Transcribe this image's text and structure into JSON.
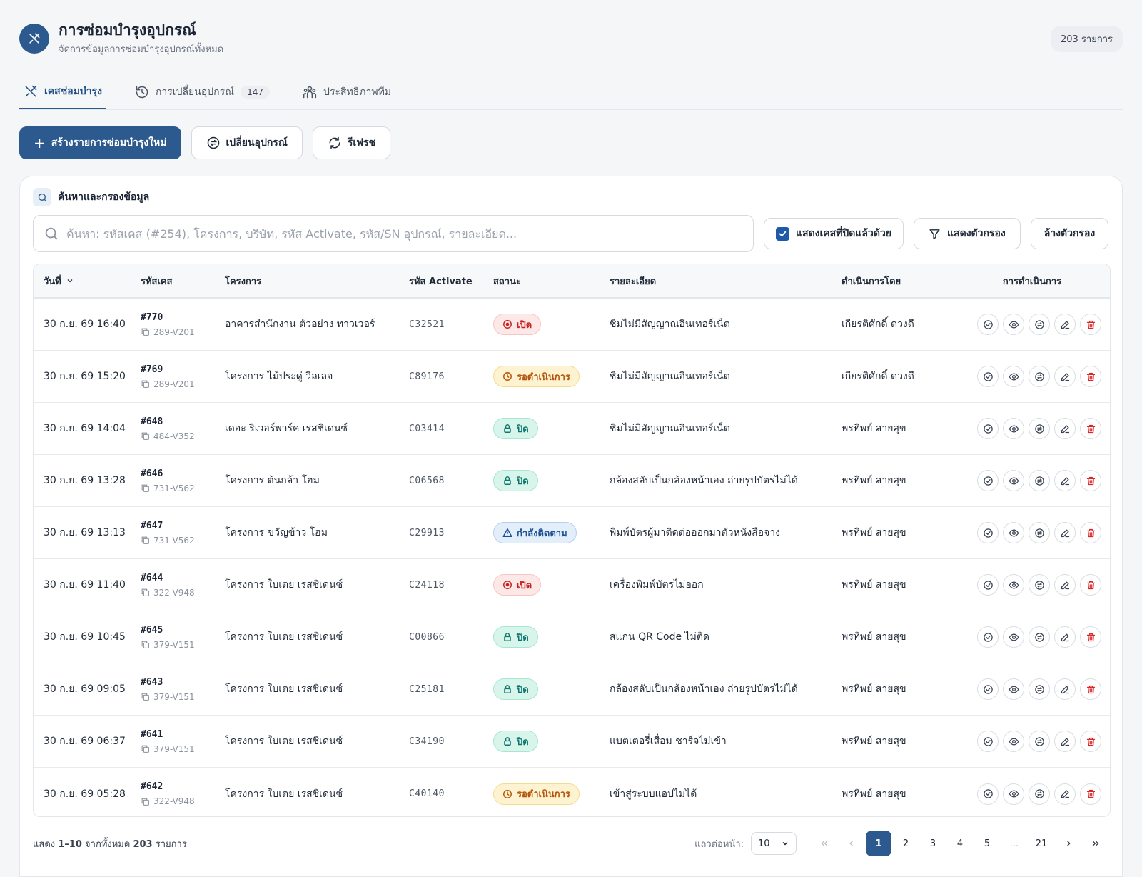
{
  "header": {
    "title": "การซ่อมบำรุงอุปกรณ์",
    "subtitle": "จัดการข้อมูลการซ่อมบำรุงอุปกรณ์ทั้งหมด",
    "count": "203 รายการ"
  },
  "tabs": [
    {
      "label": "เคสซ่อมบำรุง",
      "icon": "tools-icon",
      "active": true
    },
    {
      "label": "การเปลี่ยนอุปกรณ์",
      "icon": "history-icon",
      "count": "147"
    },
    {
      "label": "ประสิทธิภาพทีม",
      "icon": "team-icon"
    }
  ],
  "actions": {
    "create": "สร้างรายการซ่อมบำรุงใหม่",
    "replace": "เปลี่ยนอุปกรณ์",
    "refresh": "รีเฟรช"
  },
  "filter": {
    "title": "ค้นหาและกรองข้อมูล",
    "placeholder": "ค้นหา: รหัสเคส (#254), โครงการ, บริษัท, รหัส Activate, รหัส/SN อุปกรณ์, รายละเอียด...",
    "show_closed": "แสดงเคสที่ปิดแล้วด้วย",
    "show_filters": "แสดงตัวกรอง",
    "clear_filters": "ล้างตัวกรอง"
  },
  "table": {
    "columns": {
      "date": "วันที่",
      "code": "รหัสเคส",
      "project": "โครงการ",
      "activate": "รหัส Activate",
      "status": "สถานะ",
      "detail": "รายละเอียด",
      "by": "ดำเนินการโดย",
      "ops": "การดำเนินการ"
    },
    "rows": [
      {
        "date": "30 ก.ย. 69 16:40",
        "case": "#770",
        "device": "289-V201",
        "project": "อาคารสำนักงาน ตัวอย่าง ทาวเวอร์",
        "activate": "C32521",
        "status": "เปิด",
        "status_type": "open",
        "detail": "ซิมไม่มีสัญญาณอินเทอร์เน็ต",
        "by": "เกียรติศักดิ์ ดวงดี"
      },
      {
        "date": "30 ก.ย. 69 15:20",
        "case": "#769",
        "device": "289-V201",
        "project": "โครงการ ไม้ประดู่ วิลเลจ",
        "activate": "C89176",
        "status": "รอดำเนินการ",
        "status_type": "pending",
        "detail": "ซิมไม่มีสัญญาณอินเทอร์เน็ต",
        "by": "เกียรติศักดิ์ ดวงดี"
      },
      {
        "date": "30 ก.ย. 69 14:04",
        "case": "#648",
        "device": "484-V352",
        "project": "เดอะ ริเวอร์พาร์ค เรสซิเดนซ์",
        "activate": "C03414",
        "status": "ปิด",
        "status_type": "closed",
        "detail": "ซิมไม่มีสัญญาณอินเทอร์เน็ต",
        "by": "พรทิพย์ สายสุข"
      },
      {
        "date": "30 ก.ย. 69 13:28",
        "case": "#646",
        "device": "731-V562",
        "project": "โครงการ ต้นกล้า โฮม",
        "activate": "C06568",
        "status": "ปิด",
        "status_type": "closed",
        "detail": "กล้องสลับเป็นกล้องหน้าเอง ถ่ายรูปบัตรไม่ได้",
        "by": "พรทิพย์ สายสุข"
      },
      {
        "date": "30 ก.ย. 69 13:13",
        "case": "#647",
        "device": "731-V562",
        "project": "โครงการ ขวัญข้าว โฮม",
        "activate": "C29913",
        "status": "กำลังติดตาม",
        "status_type": "tracking",
        "detail": "พิมพ์บัตรผู้มาติดต่อออกมาตัวหนังสือจาง",
        "by": "พรทิพย์ สายสุข"
      },
      {
        "date": "30 ก.ย. 69 11:40",
        "case": "#644",
        "device": "322-V948",
        "project": "โครงการ ใบเตย เรสซิเดนซ์",
        "activate": "C24118",
        "status": "เปิด",
        "status_type": "open",
        "detail": "เครื่องพิมพ์บัตรไม่ออก",
        "by": "พรทิพย์ สายสุข"
      },
      {
        "date": "30 ก.ย. 69 10:45",
        "case": "#645",
        "device": "379-V151",
        "project": "โครงการ ใบเตย เรสซิเดนซ์",
        "activate": "C00866",
        "status": "ปิด",
        "status_type": "closed",
        "detail": "สแกน QR Code ไม่ติด",
        "by": "พรทิพย์ สายสุข"
      },
      {
        "date": "30 ก.ย. 69 09:05",
        "case": "#643",
        "device": "379-V151",
        "project": "โครงการ ใบเตย เรสซิเดนซ์",
        "activate": "C25181",
        "status": "ปิด",
        "status_type": "closed",
        "detail": "กล้องสลับเป็นกล้องหน้าเอง ถ่ายรูปบัตรไม่ได้",
        "by": "พรทิพย์ สายสุข"
      },
      {
        "date": "30 ก.ย. 69 06:37",
        "case": "#641",
        "device": "379-V151",
        "project": "โครงการ ใบเตย เรสซิเดนซ์",
        "activate": "C34190",
        "status": "ปิด",
        "status_type": "closed",
        "detail": "แบตเตอรี่เสื่อม ชาร์จไม่เข้า",
        "by": "พรทิพย์ สายสุข"
      },
      {
        "date": "30 ก.ย. 69 05:28",
        "case": "#642",
        "device": "322-V948",
        "project": "โครงการ ใบเตย เรสซิเดนซ์",
        "activate": "C40140",
        "status": "รอดำเนินการ",
        "status_type": "pending",
        "detail": "เข้าสู่ระบบแอปไม่ได้",
        "by": "พรทิพย์ สายสุข"
      }
    ]
  },
  "footer": {
    "info_prefix": "แสดง",
    "info_range": "1–10",
    "info_middle": "จากทั้งหมด",
    "info_total": "203",
    "info_suffix": "รายการ",
    "rows_label": "แถวต่อหน้า:",
    "rows_value": "10",
    "pages": [
      "1",
      "2",
      "3",
      "4",
      "5",
      "...",
      "21"
    ],
    "current_page": "1"
  },
  "colors": {
    "primary": "#2d5a8e",
    "open": "#c81e1e",
    "pending": "#b45309",
    "closed": "#0f766e",
    "tracking": "#1d4f91"
  }
}
